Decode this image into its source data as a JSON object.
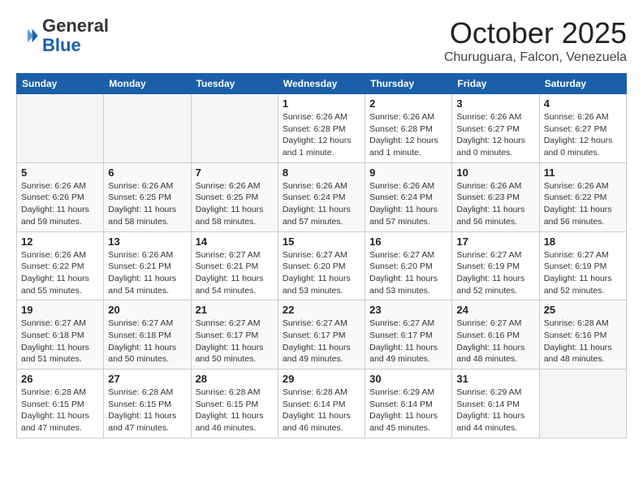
{
  "logo": {
    "text_general": "General",
    "text_blue": "Blue"
  },
  "header": {
    "month": "October 2025",
    "location": "Churuguara, Falcon, Venezuela"
  },
  "weekdays": [
    "Sunday",
    "Monday",
    "Tuesday",
    "Wednesday",
    "Thursday",
    "Friday",
    "Saturday"
  ],
  "weeks": [
    [
      {
        "day": "",
        "info": ""
      },
      {
        "day": "",
        "info": ""
      },
      {
        "day": "",
        "info": ""
      },
      {
        "day": "1",
        "info": "Sunrise: 6:26 AM\nSunset: 6:28 PM\nDaylight: 12 hours\nand 1 minute."
      },
      {
        "day": "2",
        "info": "Sunrise: 6:26 AM\nSunset: 6:28 PM\nDaylight: 12 hours\nand 1 minute."
      },
      {
        "day": "3",
        "info": "Sunrise: 6:26 AM\nSunset: 6:27 PM\nDaylight: 12 hours\nand 0 minutes."
      },
      {
        "day": "4",
        "info": "Sunrise: 6:26 AM\nSunset: 6:27 PM\nDaylight: 12 hours\nand 0 minutes."
      }
    ],
    [
      {
        "day": "5",
        "info": "Sunrise: 6:26 AM\nSunset: 6:26 PM\nDaylight: 11 hours\nand 59 minutes."
      },
      {
        "day": "6",
        "info": "Sunrise: 6:26 AM\nSunset: 6:25 PM\nDaylight: 11 hours\nand 58 minutes."
      },
      {
        "day": "7",
        "info": "Sunrise: 6:26 AM\nSunset: 6:25 PM\nDaylight: 11 hours\nand 58 minutes."
      },
      {
        "day": "8",
        "info": "Sunrise: 6:26 AM\nSunset: 6:24 PM\nDaylight: 11 hours\nand 57 minutes."
      },
      {
        "day": "9",
        "info": "Sunrise: 6:26 AM\nSunset: 6:24 PM\nDaylight: 11 hours\nand 57 minutes."
      },
      {
        "day": "10",
        "info": "Sunrise: 6:26 AM\nSunset: 6:23 PM\nDaylight: 11 hours\nand 56 minutes."
      },
      {
        "day": "11",
        "info": "Sunrise: 6:26 AM\nSunset: 6:22 PM\nDaylight: 11 hours\nand 56 minutes."
      }
    ],
    [
      {
        "day": "12",
        "info": "Sunrise: 6:26 AM\nSunset: 6:22 PM\nDaylight: 11 hours\nand 55 minutes."
      },
      {
        "day": "13",
        "info": "Sunrise: 6:26 AM\nSunset: 6:21 PM\nDaylight: 11 hours\nand 54 minutes."
      },
      {
        "day": "14",
        "info": "Sunrise: 6:27 AM\nSunset: 6:21 PM\nDaylight: 11 hours\nand 54 minutes."
      },
      {
        "day": "15",
        "info": "Sunrise: 6:27 AM\nSunset: 6:20 PM\nDaylight: 11 hours\nand 53 minutes."
      },
      {
        "day": "16",
        "info": "Sunrise: 6:27 AM\nSunset: 6:20 PM\nDaylight: 11 hours\nand 53 minutes."
      },
      {
        "day": "17",
        "info": "Sunrise: 6:27 AM\nSunset: 6:19 PM\nDaylight: 11 hours\nand 52 minutes."
      },
      {
        "day": "18",
        "info": "Sunrise: 6:27 AM\nSunset: 6:19 PM\nDaylight: 11 hours\nand 52 minutes."
      }
    ],
    [
      {
        "day": "19",
        "info": "Sunrise: 6:27 AM\nSunset: 6:18 PM\nDaylight: 11 hours\nand 51 minutes."
      },
      {
        "day": "20",
        "info": "Sunrise: 6:27 AM\nSunset: 6:18 PM\nDaylight: 11 hours\nand 50 minutes."
      },
      {
        "day": "21",
        "info": "Sunrise: 6:27 AM\nSunset: 6:17 PM\nDaylight: 11 hours\nand 50 minutes."
      },
      {
        "day": "22",
        "info": "Sunrise: 6:27 AM\nSunset: 6:17 PM\nDaylight: 11 hours\nand 49 minutes."
      },
      {
        "day": "23",
        "info": "Sunrise: 6:27 AM\nSunset: 6:17 PM\nDaylight: 11 hours\nand 49 minutes."
      },
      {
        "day": "24",
        "info": "Sunrise: 6:27 AM\nSunset: 6:16 PM\nDaylight: 11 hours\nand 48 minutes."
      },
      {
        "day": "25",
        "info": "Sunrise: 6:28 AM\nSunset: 6:16 PM\nDaylight: 11 hours\nand 48 minutes."
      }
    ],
    [
      {
        "day": "26",
        "info": "Sunrise: 6:28 AM\nSunset: 6:15 PM\nDaylight: 11 hours\nand 47 minutes."
      },
      {
        "day": "27",
        "info": "Sunrise: 6:28 AM\nSunset: 6:15 PM\nDaylight: 11 hours\nand 47 minutes."
      },
      {
        "day": "28",
        "info": "Sunrise: 6:28 AM\nSunset: 6:15 PM\nDaylight: 11 hours\nand 46 minutes."
      },
      {
        "day": "29",
        "info": "Sunrise: 6:28 AM\nSunset: 6:14 PM\nDaylight: 11 hours\nand 46 minutes."
      },
      {
        "day": "30",
        "info": "Sunrise: 6:29 AM\nSunset: 6:14 PM\nDaylight: 11 hours\nand 45 minutes."
      },
      {
        "day": "31",
        "info": "Sunrise: 6:29 AM\nSunset: 6:14 PM\nDaylight: 11 hours\nand 44 minutes."
      },
      {
        "day": "",
        "info": ""
      }
    ]
  ]
}
